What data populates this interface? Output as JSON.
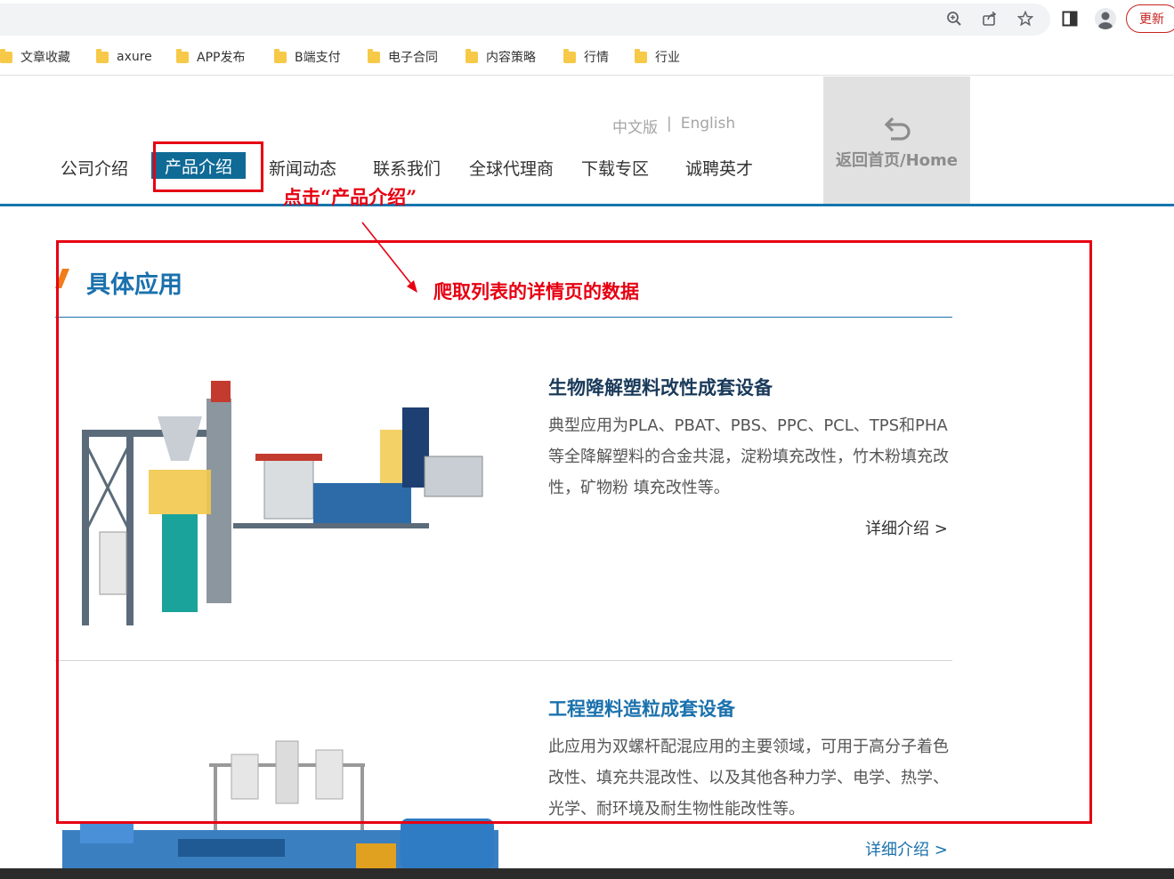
{
  "bookmarks": [
    {
      "label": "文章收藏"
    },
    {
      "label": "axure"
    },
    {
      "label": "APP发布"
    },
    {
      "label": "B端支付"
    },
    {
      "label": "电子合同"
    },
    {
      "label": "内容策略"
    },
    {
      "label": "行情"
    },
    {
      "label": "行业"
    }
  ],
  "browser": {
    "update_label": "更新"
  },
  "header": {
    "lang_cn": "中文版",
    "lang_sep": "|",
    "lang_en": "English",
    "home_label": "返回首页/Home"
  },
  "nav": [
    {
      "label": "公司介绍",
      "active": false
    },
    {
      "label": "产品介绍",
      "active": true
    },
    {
      "label": "新闻动态",
      "active": false
    },
    {
      "label": "联系我们",
      "active": false
    },
    {
      "label": "全球代理商",
      "active": false
    },
    {
      "label": "下载专区",
      "active": false
    },
    {
      "label": "诚聘英才",
      "active": false
    }
  ],
  "annotations": {
    "click_note": "点击“产品介绍”",
    "crawl_note": "爬取列表的详情页的数据",
    "color": "#e60012"
  },
  "section": {
    "title": "具体应用"
  },
  "products": [
    {
      "title": "生物降解塑料改性成套设备",
      "description": "典型应用为PLA、PBAT、PBS、PPC、PCL、TPS和PHA等全降解塑料的合金共混，淀粉填充改性，竹木粉填充改性，矿物粉 填充改性等。",
      "more": "详细介绍 >"
    },
    {
      "title": "工程塑料造粒成套设备",
      "description": "此应用为双螺杆配混应用的主要领域，可用于高分子着色改性、填充共混改性、以及其他各种力学、电学、热学、光学、耐环境及耐生物性能改性等。",
      "more": "详细介绍 >"
    }
  ],
  "colors": {
    "brand_blue": "#1a71ad",
    "nav_active": "#0f6a96",
    "accent_orange": "#f07c1a"
  },
  "icons": [
    "zoom-icon",
    "share-icon",
    "star-icon",
    "sidepanel-icon",
    "profile-icon",
    "folder-icon",
    "return-icon"
  ]
}
